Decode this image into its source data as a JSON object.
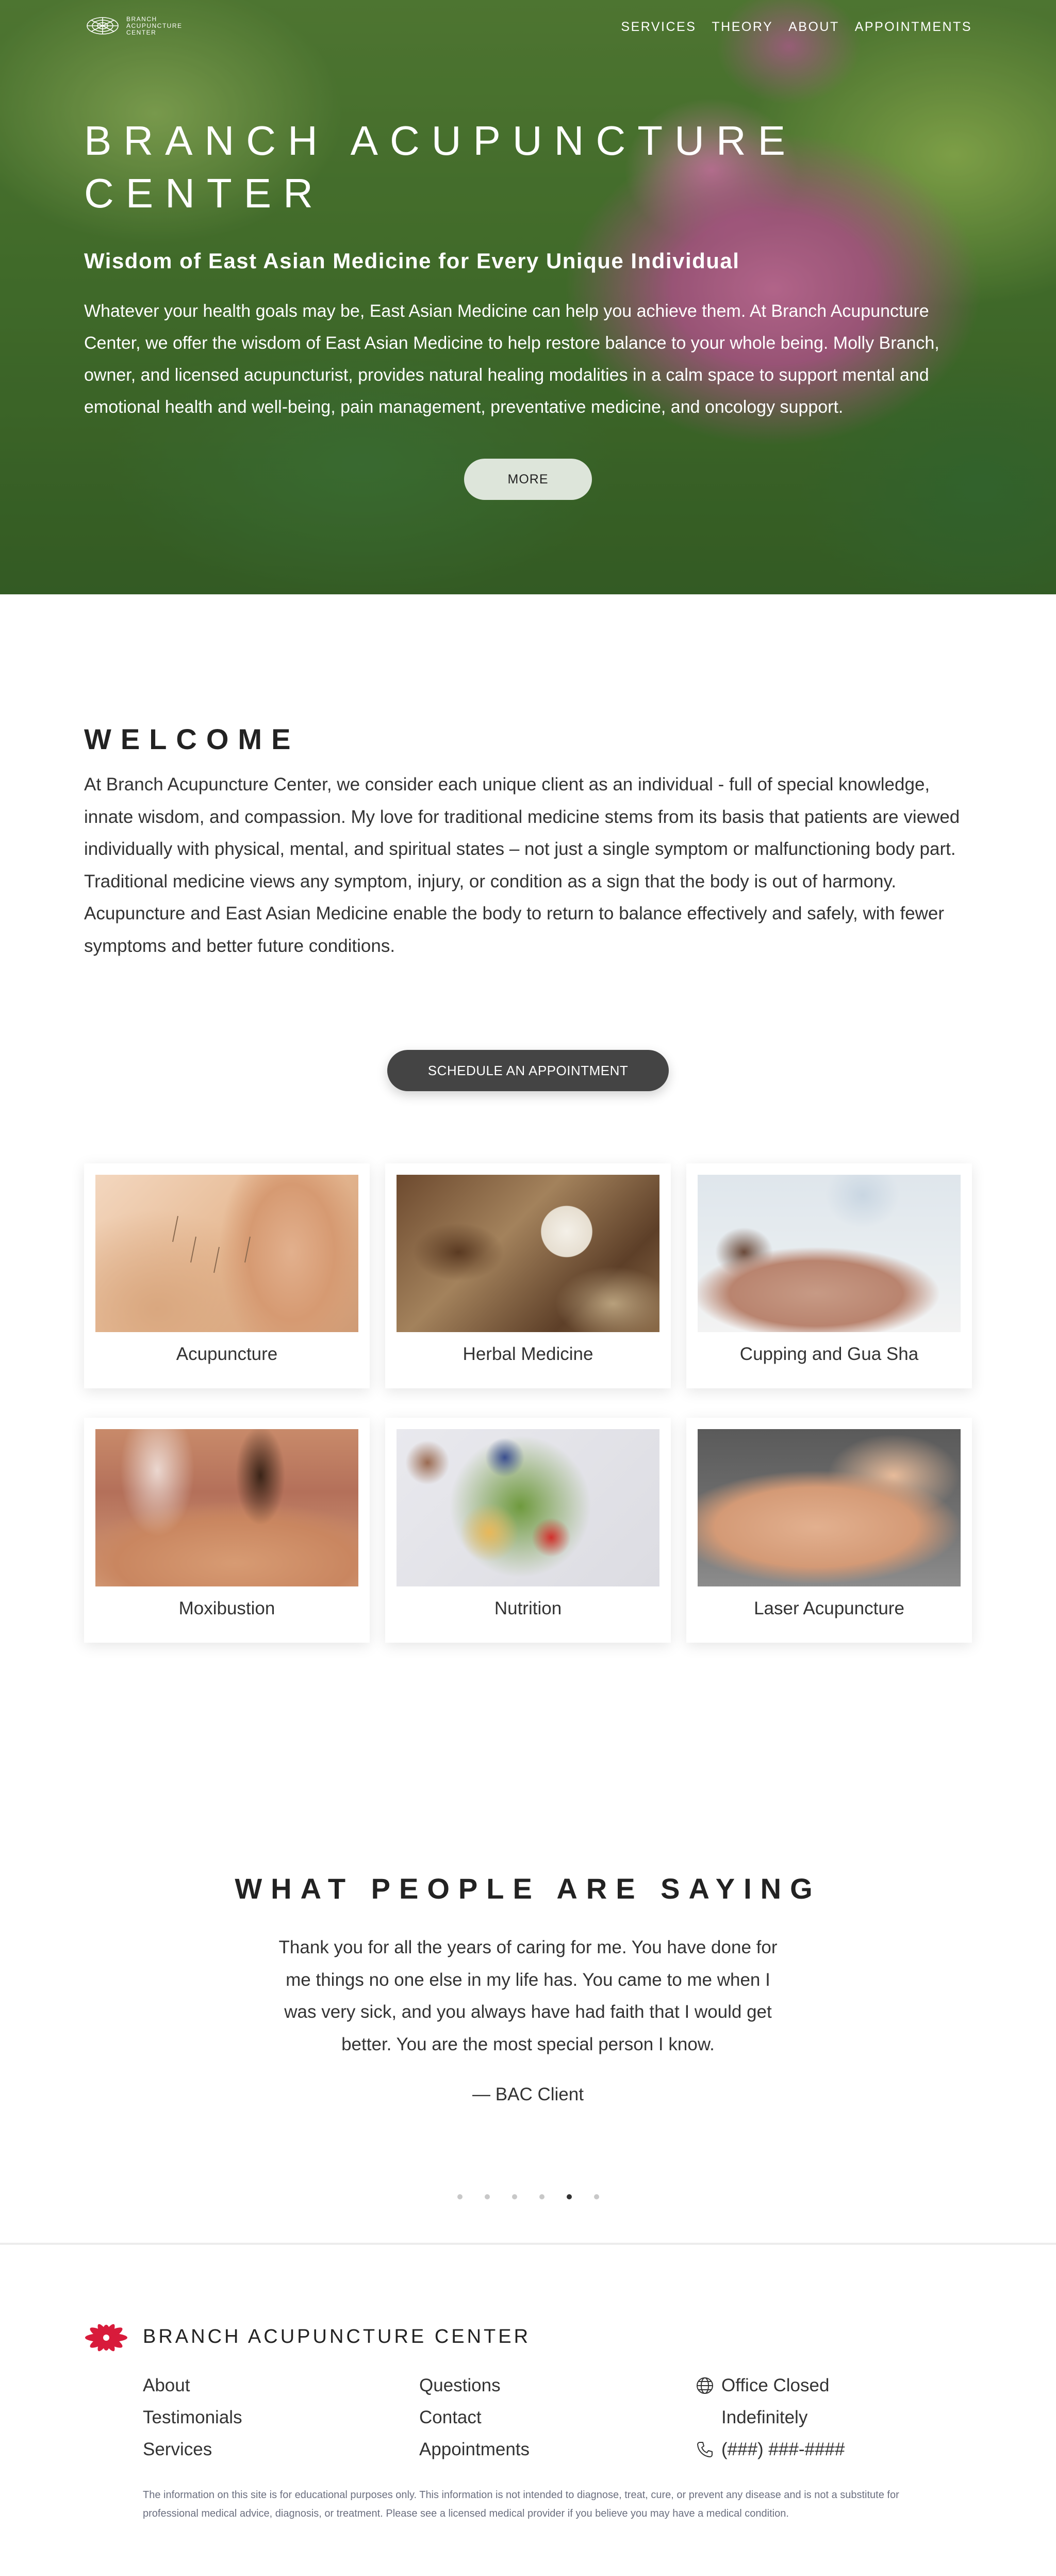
{
  "brand": {
    "name": "BRANCH ACUPUNCTURE CENTER",
    "logo_lines": [
      "BRANCH",
      "ACUPUNCTURE",
      "CENTER"
    ],
    "logo_icon": "lotus-icon",
    "accent_color": "#d81b3b"
  },
  "nav": {
    "items": [
      {
        "label": "SERVICES"
      },
      {
        "label": "THEORY"
      },
      {
        "label": "ABOUT"
      },
      {
        "label": "APPOINTMENTS"
      }
    ]
  },
  "hero": {
    "title_line1": "BRANCH ACUPUNCTURE",
    "title_line2": "CENTER",
    "subtitle": "Wisdom of East Asian Medicine for Every Unique Individual",
    "body": "Whatever your health goals may be, East Asian Medicine can help you achieve them. At Branch Acupuncture Center, we offer the wisdom of East Asian Medicine to help restore balance to your whole being. Molly Branch, owner, and licensed acupuncturist, provides natural healing modalities in a calm space to support mental and emotional health and well-being, pain management, preventative medicine, and oncology support.",
    "button": "MORE"
  },
  "welcome": {
    "title": "WELCOME",
    "body": "At Branch Acupuncture Center, we consider each unique client as an individual - full of special knowledge, innate wisdom, and compassion. My love for traditional medicine stems from its basis that patients are viewed individually with physical, mental, and spiritual states – not just a single symptom or malfunctioning body part. Traditional medicine views any symptom, injury, or condition as a sign that the body is out of harmony. Acupuncture and East Asian Medicine enable the body to return to balance effectively and safely, with fewer symptoms and better future conditions.",
    "button": "SCHEDULE AN APPOINTMENT"
  },
  "services": [
    {
      "label": "Acupuncture"
    },
    {
      "label": "Herbal Medicine"
    },
    {
      "label": "Cupping and Gua Sha"
    },
    {
      "label": "Moxibustion"
    },
    {
      "label": "Nutrition"
    },
    {
      "label": "Laser Acupuncture"
    }
  ],
  "testimonials": {
    "title": "WHAT PEOPLE ARE SAYING",
    "quote": "Thank you for all the years of caring for me. You have done for me things no one else in my life has. You came to me when I was very sick, and you always have had faith that I would get better. You are the most special person I know.",
    "author": "— BAC Client",
    "dot_count": 6,
    "active_dot": 5
  },
  "footer": {
    "name": "BRANCH ACUPUNCTURE CENTER",
    "col1": [
      "About",
      "Testimonials",
      "Services"
    ],
    "col2": [
      "Questions",
      "Contact",
      "Appointments"
    ],
    "status_line1": "Office Closed",
    "status_line2": "Indefinitely",
    "phone": "(###) ###-####",
    "status_icon": "globe-icon",
    "phone_icon": "phone-icon",
    "note": "The information on this site is for educational purposes only. This information is not intended to diagnose, treat, cure, or prevent any disease and is not a substitute for professional medical advice, diagnosis, or treatment. Please see a licensed medical provider if you believe you may have a medical condition."
  }
}
